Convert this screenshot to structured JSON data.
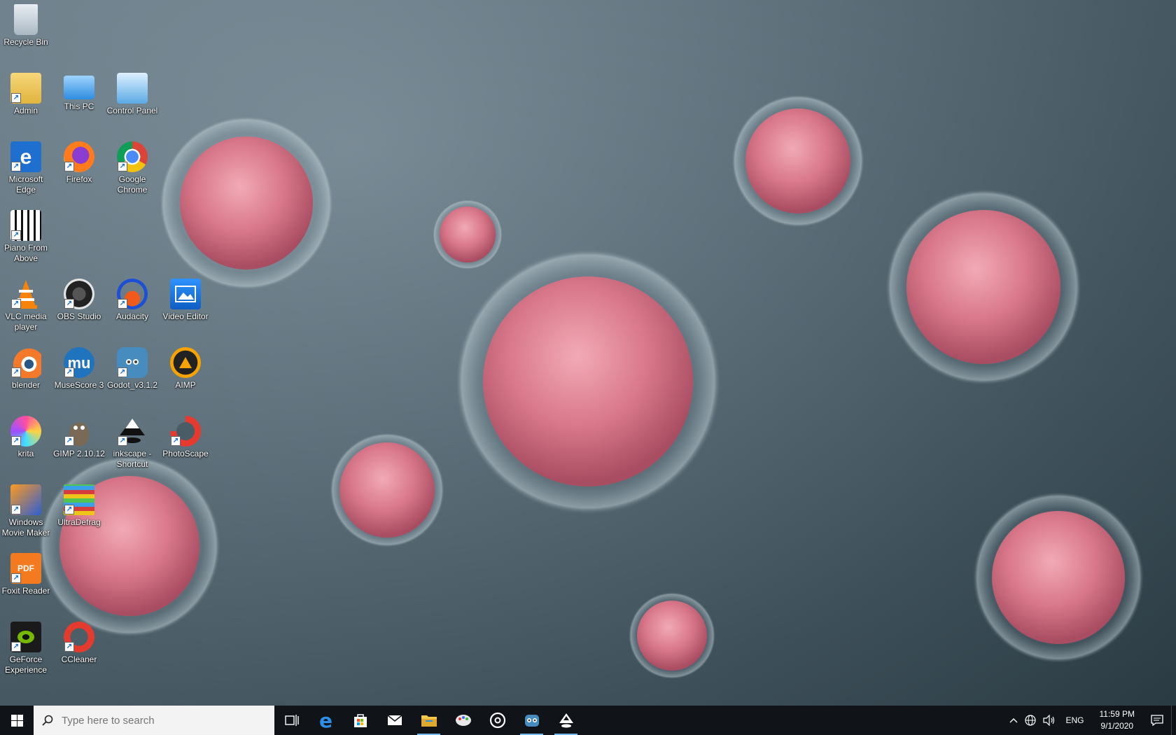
{
  "desktop": {
    "icons": [
      {
        "label": "Recycle Bin",
        "icon": "recycle-bin-icon"
      },
      {
        "label": "Admin",
        "icon": "user-folder-icon"
      },
      {
        "label": "This PC",
        "icon": "computer-icon"
      },
      {
        "label": "Control Panel",
        "icon": "control-panel-icon"
      },
      {
        "label": "Microsoft Edge",
        "icon": "edge-icon"
      },
      {
        "label": "Firefox",
        "icon": "firefox-icon"
      },
      {
        "label": "Google Chrome",
        "icon": "chrome-icon"
      },
      {
        "label": "Piano From Above",
        "icon": "piano-icon"
      },
      {
        "label": "VLC media player",
        "icon": "vlc-icon"
      },
      {
        "label": "OBS Studio",
        "icon": "obs-icon"
      },
      {
        "label": "Audacity",
        "icon": "audacity-icon"
      },
      {
        "label": "Video Editor",
        "icon": "video-editor-icon"
      },
      {
        "label": "blender",
        "icon": "blender-icon"
      },
      {
        "label": "MuseScore 3",
        "icon": "musescore-icon"
      },
      {
        "label": "Godot_v3.1.2",
        "icon": "godot-icon"
      },
      {
        "label": "AIMP",
        "icon": "aimp-icon"
      },
      {
        "label": "krita",
        "icon": "krita-icon"
      },
      {
        "label": "GIMP 2.10.12",
        "icon": "gimp-icon"
      },
      {
        "label": "inkscape - Shortcut",
        "icon": "inkscape-icon"
      },
      {
        "label": "PhotoScape",
        "icon": "photoscape-icon"
      },
      {
        "label": "Windows Movie Maker",
        "icon": "movie-maker-icon"
      },
      {
        "label": "UltraDefrag",
        "icon": "ultradefrag-icon"
      },
      {
        "label": "Foxit Reader",
        "icon": "foxit-icon"
      },
      {
        "label": "GeForce Experience",
        "icon": "geforce-icon"
      },
      {
        "label": "CCleaner",
        "icon": "ccleaner-icon"
      }
    ]
  },
  "taskbar": {
    "search_placeholder": "Type here to search",
    "pinned": [
      "task-view-icon",
      "edge-icon",
      "store-icon",
      "mail-icon",
      "file-explorer-icon",
      "paint-icon",
      "groove-icon",
      "godot-icon",
      "inkscape-icon"
    ],
    "tray": {
      "language": "ENG",
      "time": "11:59 PM",
      "date": "9/1/2020"
    }
  },
  "colors": {
    "taskbar_bg": "#101418",
    "cell_pink": "#d97a8c",
    "accent": "#76b9ed"
  }
}
